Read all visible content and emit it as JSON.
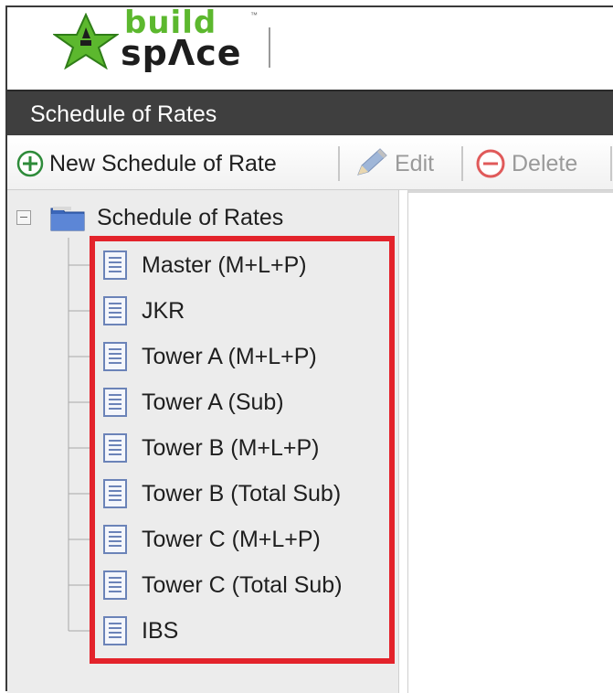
{
  "logo": {
    "word_top": "build",
    "word_bottom": "spΛce",
    "trademark": "™"
  },
  "title_bar": {
    "title": "Schedule of Rates"
  },
  "toolbar": {
    "new_label": "New Schedule of Rate",
    "edit_label": "Edit",
    "delete_label": "Delete"
  },
  "tree": {
    "root_label": "Schedule of Rates",
    "items": [
      {
        "label": "Master (M+L+P)"
      },
      {
        "label": "JKR"
      },
      {
        "label": "Tower A (M+L+P)"
      },
      {
        "label": "Tower A (Sub)"
      },
      {
        "label": "Tower B (M+L+P)"
      },
      {
        "label": "Tower B (Total Sub)"
      },
      {
        "label": "Tower C (M+L+P)"
      },
      {
        "label": "Tower C (Total Sub)"
      },
      {
        "label": "IBS"
      }
    ]
  },
  "colors": {
    "title_bar_bg": "#3f3f3f",
    "highlight_border": "#e3232b",
    "logo_green": "#5cb82e",
    "add_icon_green": "#2e8b3a",
    "delete_icon_red": "#e05a5a"
  },
  "icons": {
    "add": "plus-circle-icon",
    "edit": "pencil-icon",
    "delete": "minus-circle-icon",
    "folder": "folder-icon",
    "document": "document-icon"
  }
}
